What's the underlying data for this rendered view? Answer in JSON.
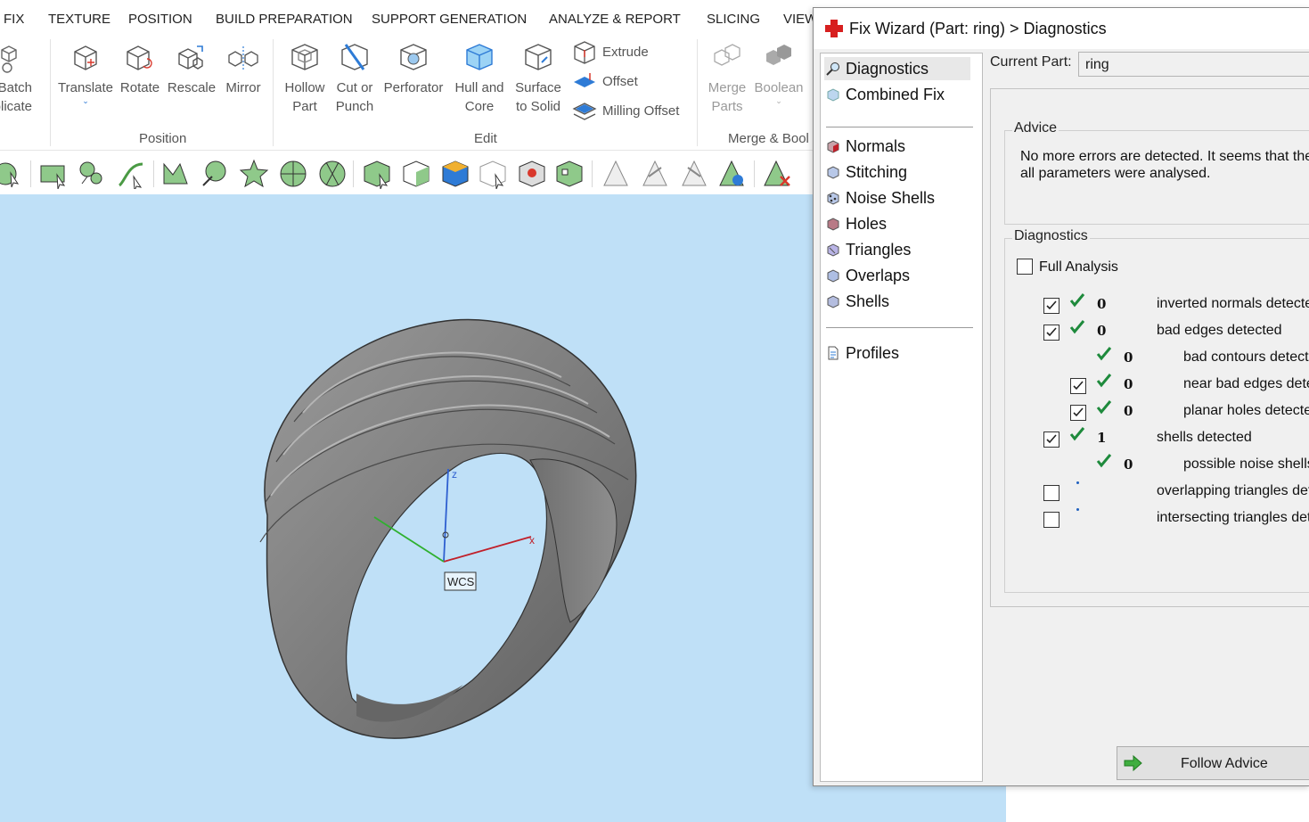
{
  "menu": [
    "FIX",
    "TEXTURE",
    "POSITION",
    "BUILD PREPARATION",
    "SUPPORT GENERATION",
    "ANALYZE & REPORT",
    "SLICING",
    "VIEW"
  ],
  "ribbon": {
    "batch_label": "Batch\nplicate",
    "position_buttons": [
      "Translate",
      "Rotate",
      "Rescale",
      "Mirror"
    ],
    "position_group": "Position",
    "edit_buttons": [
      "Hollow\nPart",
      "Cut or\nPunch",
      "Perforator",
      "Hull and\nCore",
      "Surface\nto Solid"
    ],
    "edit_small": [
      "Extrude",
      "Offset",
      "Milling Offset"
    ],
    "edit_group": "Edit",
    "merge_buttons": [
      "Merge\nParts",
      "Boolean"
    ],
    "merge_group": "Merge & Bool"
  },
  "viewport": {
    "wcs_label": "WCS",
    "axis_x": "x",
    "axis_z": "z"
  },
  "dialog": {
    "title": "Fix Wizard (Part: ring) > Diagnostics",
    "nav_top": [
      "Diagnostics",
      "Combined Fix"
    ],
    "nav_mid": [
      "Normals",
      "Stitching",
      "Noise Shells",
      "Holes",
      "Triangles",
      "Overlaps",
      "Shells"
    ],
    "nav_bottom": [
      "Profiles"
    ],
    "current_part_label": "Current Part:",
    "current_part_value": "ring",
    "advice_legend": "Advice",
    "advice_text": "No more errors are detected. It seems that the part is OK. However, not all parameters were analysed.",
    "diagnostics_legend": "Diagnostics",
    "full_analysis_label": "Full Analysis",
    "diagnostics": [
      {
        "checked": true,
        "ok": true,
        "count": "0",
        "label": "inverted normals detected"
      },
      {
        "checked": true,
        "ok": true,
        "count": "0",
        "label": "bad edges detected"
      },
      {
        "checked": null,
        "ok": true,
        "count": "0",
        "label": "bad contours detected"
      },
      {
        "checked": true,
        "ok": true,
        "count": "0",
        "label": "near bad edges detected"
      },
      {
        "checked": true,
        "ok": true,
        "count": "0",
        "label": "planar holes detected"
      },
      {
        "checked": true,
        "ok": true,
        "count": "1",
        "label": "shells detected"
      },
      {
        "checked": null,
        "ok": true,
        "count": "0",
        "label": "possible noise shells detected"
      },
      {
        "checked": false,
        "ok": false,
        "count": "",
        "label": "overlapping triangles detected"
      },
      {
        "checked": false,
        "ok": false,
        "count": "",
        "label": "intersecting triangles detected"
      }
    ],
    "follow_advice_label": "Follow Advice"
  },
  "colors": {
    "viewport_bg": "#bfe0f7",
    "check_green": "#1e8a3c",
    "accent_blue": "#2e7bd6"
  }
}
